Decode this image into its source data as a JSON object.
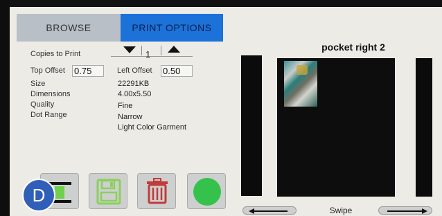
{
  "tabs": {
    "browse": "BROWSE",
    "print_options": "PRINT OPTIONS"
  },
  "options": {
    "copies_label": "Copies to Print",
    "copies_value": "1",
    "top_offset_label": "Top Offset",
    "top_offset_value": "0.75",
    "left_offset_label": "Left Offset",
    "left_offset_value": "0.50",
    "size_label": "Size",
    "size_value": "22291KB",
    "dimensions_label": "Dimensions",
    "dimensions_value": "4.00x5.50",
    "quality_label": "Quality",
    "quality_value": "Fine",
    "dot_range_label": "Dot Range",
    "dot_range_value": "Narrow",
    "garment_value": "Light Color Garment"
  },
  "preview": {
    "title": "pocket right 2",
    "swipe_label": "Swipe"
  },
  "badge": {
    "letter": "D"
  },
  "colors": {
    "tab_active": "#1c72d9",
    "print_button": "#35c24c",
    "badge": "#2f5fb8"
  },
  "icons": {
    "stepper_down": "triangle-down-icon",
    "stepper_up": "triangle-up-icon",
    "save": "floppy-disk-icon",
    "delete": "trash-can-icon",
    "print": "green-circle-icon",
    "swipe_left": "arrow-left-icon",
    "swipe_right": "arrow-right-icon"
  }
}
